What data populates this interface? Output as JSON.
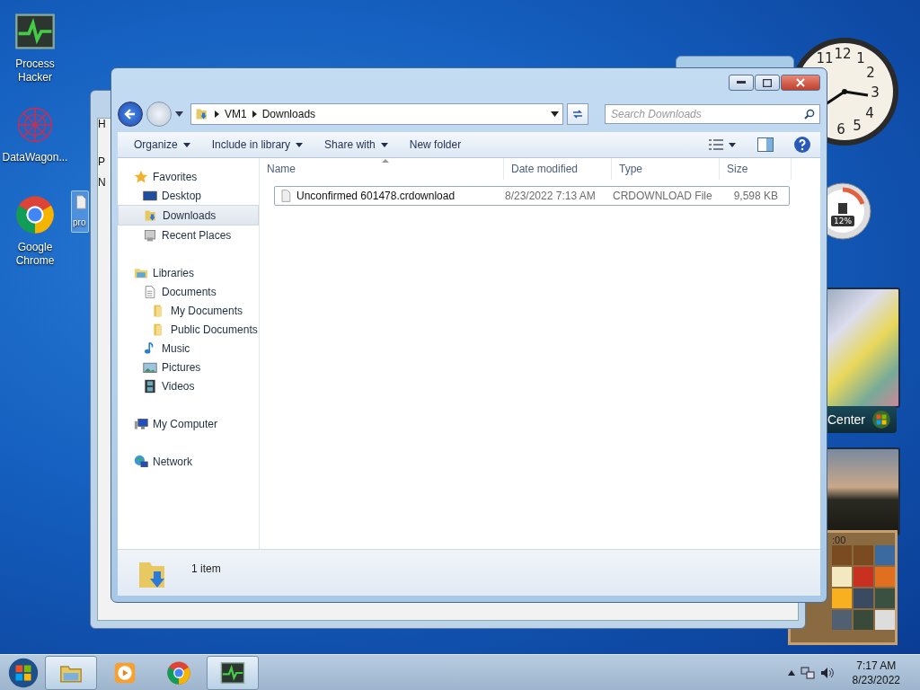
{
  "desktop_icons": [
    {
      "label": "Process Hacker",
      "kind": "hacker",
      "selected": false
    },
    {
      "label": "DataWagon...",
      "kind": "wagon",
      "selected": false
    },
    {
      "label": "Google Chrome",
      "kind": "chrome",
      "selected": false
    },
    {
      "label": "pro",
      "kind": "file",
      "selected": true
    }
  ],
  "background_window": {
    "labels": [
      "H",
      "P",
      "N"
    ]
  },
  "gadgets": {
    "clock_numerals": [
      "12",
      "1",
      "2",
      "3",
      "4",
      "5",
      "6",
      "11"
    ],
    "cpu_reading": "12%",
    "media_label": "Center",
    "puzzle_time": ":00"
  },
  "explorer": {
    "breadcrumb": [
      "VM1",
      "Downloads"
    ],
    "search": {
      "placeholder": "Search Downloads"
    },
    "toolbar": [
      {
        "label": "Organize",
        "dropdown": true
      },
      {
        "label": "Include in library",
        "dropdown": true
      },
      {
        "label": "Share with",
        "dropdown": true
      },
      {
        "label": "New folder",
        "dropdown": false
      }
    ],
    "nav": [
      {
        "label": "Favorites",
        "kind": "star",
        "selected": false,
        "children": [
          {
            "label": "Desktop",
            "kind": "desktop",
            "selected": false
          },
          {
            "label": "Downloads",
            "kind": "downloads",
            "selected": true
          },
          {
            "label": "Recent Places",
            "kind": "recent",
            "selected": false
          }
        ]
      },
      {
        "label": "Libraries",
        "kind": "library",
        "selected": false,
        "children": [
          {
            "label": "Documents",
            "kind": "document",
            "selected": false,
            "children": [
              {
                "label": "My Documents",
                "kind": "folder",
                "selected": false
              },
              {
                "label": "Public Documents",
                "kind": "folder",
                "selected": false
              }
            ]
          },
          {
            "label": "Music",
            "kind": "music",
            "selected": false
          },
          {
            "label": "Pictures",
            "kind": "pictures",
            "selected": false
          },
          {
            "label": "Videos",
            "kind": "videos",
            "selected": false
          }
        ]
      },
      {
        "label": "My Computer",
        "kind": "computer",
        "selected": false
      },
      {
        "label": "Network",
        "kind": "network",
        "selected": false
      }
    ],
    "columns": [
      {
        "label": "Name",
        "sorted": true
      },
      {
        "label": "Date modified",
        "sorted": false
      },
      {
        "label": "Type",
        "sorted": false
      },
      {
        "label": "Size",
        "sorted": false
      }
    ],
    "rows": [
      {
        "name": "Unconfirmed 601478.crdownload",
        "date": "8/23/2022 7:13 AM",
        "type": "CRDOWNLOAD File",
        "size": "9,598 KB",
        "focused": true
      }
    ],
    "status": "1 item"
  },
  "taskbar": {
    "buttons": [
      {
        "kind": "explorer",
        "active": true
      },
      {
        "kind": "media",
        "active": false
      },
      {
        "kind": "chrome",
        "active": false
      },
      {
        "kind": "hacker",
        "active": true
      }
    ],
    "time": "7:17 AM",
    "date": "8/23/2022"
  }
}
